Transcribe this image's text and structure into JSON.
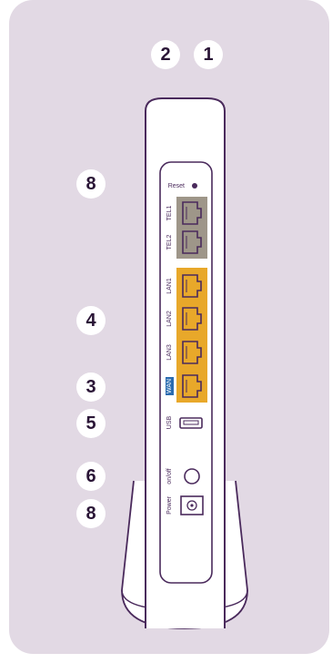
{
  "callouts": {
    "top_left": "2",
    "top_right": "1",
    "reset_marker": "8",
    "lan_marker": "4",
    "wan_marker": "3",
    "usb_marker": "5",
    "onoff_marker": "6",
    "power_marker": "8"
  },
  "ports": {
    "reset": "Reset",
    "tel1": "TEL1",
    "tel2": "TEL2",
    "lan1": "LAN1",
    "lan2": "LAN2",
    "lan3": "LAN3",
    "wan": "WAN",
    "usb": "USB",
    "onoff": "on/off",
    "power": "Power"
  },
  "colors": {
    "background": "#e2d9e4",
    "outline": "#4a2a5c",
    "tel_block": "#9e9689",
    "lan_block": "#e8a82a",
    "wan_tag": "#2b6cb0",
    "badge_text": "#2a1536"
  }
}
